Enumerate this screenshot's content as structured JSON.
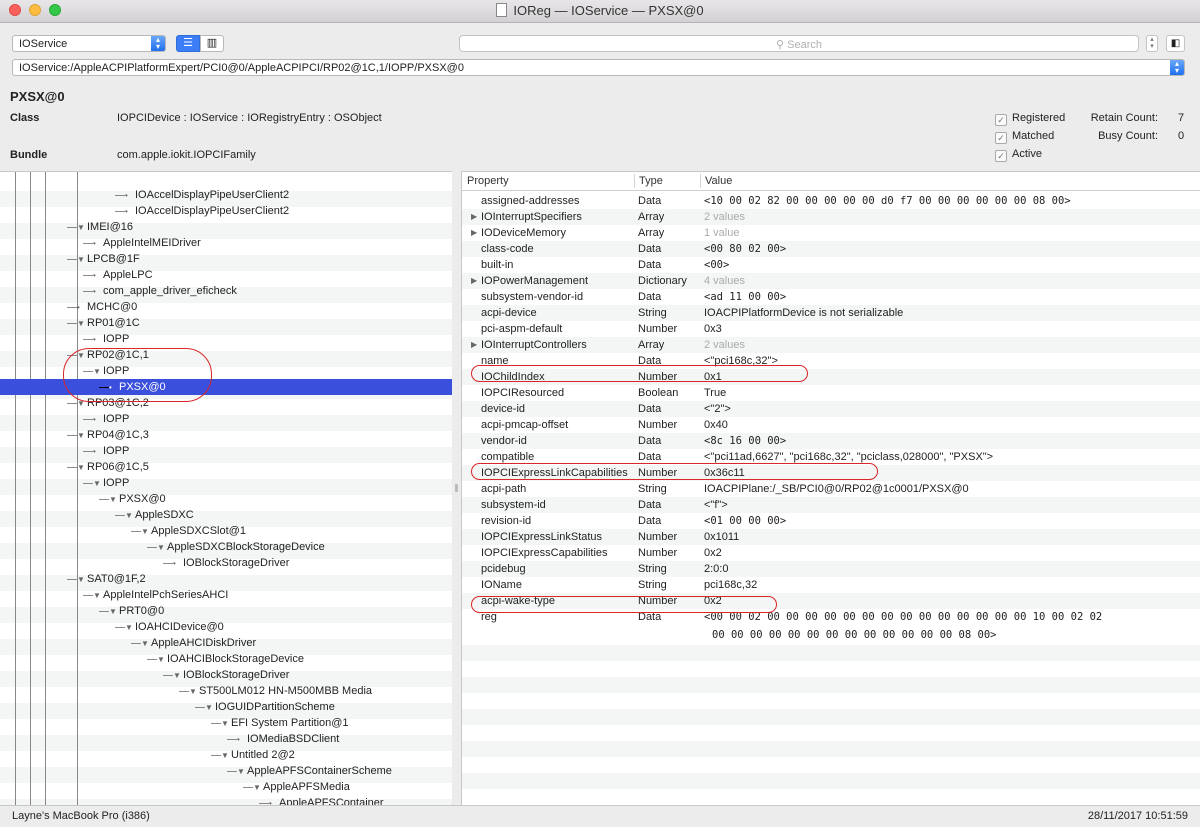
{
  "window": {
    "title": "IOReg — IOService — PXSX@0"
  },
  "toolbar": {
    "plane": "IOService",
    "search_placeholder": "Search",
    "path": "IOService:/AppleACPIPlatformExpert/PCI0@0/AppleACPIPCI/RP02@1C,1/IOPP/PXSX@0"
  },
  "info": {
    "node_title": "PXSX@0",
    "class_label": "Class",
    "class_value": "IOPCIDevice : IOService : IORegistryEntry : OSObject",
    "bundle_label": "Bundle",
    "bundle_value": "com.apple.iokit.IOPCIFamily",
    "checks": [
      "Registered",
      "Matched",
      "Active"
    ],
    "retain_label": "Retain Count:",
    "retain_value": "7",
    "busy_label": "Busy Count:",
    "busy_value": "0"
  },
  "tree": [
    {
      "label": "IOAccelDisplayPipeUserClient2",
      "depth": 8,
      "tri": false
    },
    {
      "label": "IOAccelDisplayPipeUserClient2",
      "depth": 8,
      "tri": false
    },
    {
      "label": "IMEI@16",
      "depth": 5,
      "tri": true
    },
    {
      "label": "AppleIntelMEIDriver",
      "depth": 6,
      "tri": false
    },
    {
      "label": "LPCB@1F",
      "depth": 5,
      "tri": true
    },
    {
      "label": "AppleLPC",
      "depth": 6,
      "tri": false
    },
    {
      "label": "com_apple_driver_eficheck",
      "depth": 6,
      "tri": false
    },
    {
      "label": "MCHC@0",
      "depth": 5,
      "tri": false
    },
    {
      "label": "RP01@1C",
      "depth": 5,
      "tri": true
    },
    {
      "label": "IOPP",
      "depth": 6,
      "tri": false
    },
    {
      "label": "RP02@1C,1",
      "depth": 5,
      "tri": true
    },
    {
      "label": "IOPP",
      "depth": 6,
      "tri": true
    },
    {
      "label": "PXSX@0",
      "depth": 7,
      "tri": false,
      "selected": true
    },
    {
      "label": "RP03@1C,2",
      "depth": 5,
      "tri": true
    },
    {
      "label": "IOPP",
      "depth": 6,
      "tri": false
    },
    {
      "label": "RP04@1C,3",
      "depth": 5,
      "tri": true
    },
    {
      "label": "IOPP",
      "depth": 6,
      "tri": false
    },
    {
      "label": "RP06@1C,5",
      "depth": 5,
      "tri": true
    },
    {
      "label": "IOPP",
      "depth": 6,
      "tri": true
    },
    {
      "label": "PXSX@0",
      "depth": 7,
      "tri": true
    },
    {
      "label": "AppleSDXC",
      "depth": 8,
      "tri": true
    },
    {
      "label": "AppleSDXCSlot@1",
      "depth": 9,
      "tri": true
    },
    {
      "label": "AppleSDXCBlockStorageDevice",
      "depth": 10,
      "tri": true
    },
    {
      "label": "IOBlockStorageDriver",
      "depth": 11,
      "tri": false
    },
    {
      "label": "SAT0@1F,2",
      "depth": 5,
      "tri": true
    },
    {
      "label": "AppleIntelPchSeriesAHCI",
      "depth": 6,
      "tri": true
    },
    {
      "label": "PRT0@0",
      "depth": 7,
      "tri": true
    },
    {
      "label": "IOAHCIDevice@0",
      "depth": 8,
      "tri": true
    },
    {
      "label": "AppleAHCIDiskDriver",
      "depth": 9,
      "tri": true
    },
    {
      "label": "IOAHCIBlockStorageDevice",
      "depth": 10,
      "tri": true
    },
    {
      "label": "IOBlockStorageDriver",
      "depth": 11,
      "tri": true
    },
    {
      "label": "ST500LM012 HN-M500MBB Media",
      "depth": 12,
      "tri": true
    },
    {
      "label": "IOGUIDPartitionScheme",
      "depth": 13,
      "tri": true
    },
    {
      "label": "EFI System Partition@1",
      "depth": 14,
      "tri": true
    },
    {
      "label": "IOMediaBSDClient",
      "depth": 15,
      "tri": false
    },
    {
      "label": "Untitled 2@2",
      "depth": 14,
      "tri": true
    },
    {
      "label": "AppleAPFSContainerScheme",
      "depth": 15,
      "tri": true
    },
    {
      "label": "AppleAPFSMedia",
      "depth": 16,
      "tri": true
    },
    {
      "label": "AppleAPFSContainer",
      "depth": 17,
      "tri": false
    }
  ],
  "columns": {
    "property": "Property",
    "type": "Type",
    "value": "Value"
  },
  "properties": [
    {
      "p": "assigned-addresses",
      "t": "Data",
      "v": "<10 00 02 82 00 00 00 00 00 d0 f7 00 00 00 00 00 00 08 00>",
      "mono": true
    },
    {
      "p": "IOInterruptSpecifiers",
      "t": "Array",
      "v": "2 values",
      "dim": true,
      "tri": true
    },
    {
      "p": "IODeviceMemory",
      "t": "Array",
      "v": "1 value",
      "dim": true,
      "tri": true
    },
    {
      "p": "class-code",
      "t": "Data",
      "v": "<00 80 02 00>",
      "mono": true
    },
    {
      "p": "built-in",
      "t": "Data",
      "v": "<00>",
      "mono": true
    },
    {
      "p": "IOPowerManagement",
      "t": "Dictionary",
      "v": "4 values",
      "dim": true,
      "tri": true
    },
    {
      "p": "subsystem-vendor-id",
      "t": "Data",
      "v": "<ad 11 00 00>",
      "mono": true
    },
    {
      "p": "acpi-device",
      "t": "String",
      "v": "IOACPIPlatformDevice is not serializable"
    },
    {
      "p": "pci-aspm-default",
      "t": "Number",
      "v": "0x3"
    },
    {
      "p": "IOInterruptControllers",
      "t": "Array",
      "v": "2 values",
      "dim": true,
      "tri": true
    },
    {
      "p": "name",
      "t": "Data",
      "v": "<\"pci168c,32\">"
    },
    {
      "p": "IOChildIndex",
      "t": "Number",
      "v": "0x1"
    },
    {
      "p": "IOPCIResourced",
      "t": "Boolean",
      "v": "True"
    },
    {
      "p": "device-id",
      "t": "Data",
      "v": "<\"2\">"
    },
    {
      "p": "acpi-pmcap-offset",
      "t": "Number",
      "v": "0x40"
    },
    {
      "p": "vendor-id",
      "t": "Data",
      "v": "<8c 16 00 00>",
      "mono": true
    },
    {
      "p": "compatible",
      "t": "Data",
      "v": "<\"pci11ad,6627\", \"pci168c,32\", \"pciclass,028000\", \"PXSX\">"
    },
    {
      "p": "IOPCIExpressLinkCapabilities",
      "t": "Number",
      "v": "0x36c11"
    },
    {
      "p": "acpi-path",
      "t": "String",
      "v": "IOACPIPlane:/_SB/PCI0@0/RP02@1c0001/PXSX@0"
    },
    {
      "p": "subsystem-id",
      "t": "Data",
      "v": "<\"f\">"
    },
    {
      "p": "revision-id",
      "t": "Data",
      "v": "<01 00 00 00>",
      "mono": true
    },
    {
      "p": "IOPCIExpressLinkStatus",
      "t": "Number",
      "v": "0x1011"
    },
    {
      "p": "IOPCIExpressCapabilities",
      "t": "Number",
      "v": "0x2"
    },
    {
      "p": "pcidebug",
      "t": "String",
      "v": "2:0:0"
    },
    {
      "p": "IOName",
      "t": "String",
      "v": "pci168c,32"
    },
    {
      "p": "acpi-wake-type",
      "t": "Number",
      "v": "0x2"
    },
    {
      "p": "reg",
      "t": "Data",
      "v": "<00 00 02 00 00 00 00 00 00 00 00 00 00 00 00 00 00 10 00 02 02",
      "v2": "00 00 00 00 00 00 00 00 00 00 00 00 00 08 00>",
      "mono": true
    }
  ],
  "status": {
    "machine": "Layne's MacBook Pro (i386)",
    "datetime": "28/11/2017 10:51:59"
  }
}
